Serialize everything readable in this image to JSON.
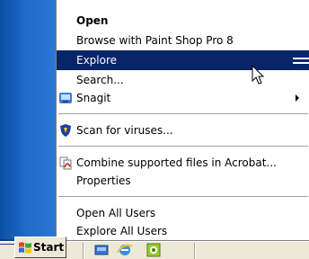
{
  "context_menu": {
    "items": [
      {
        "label": "Open"
      },
      {
        "label": "Browse with Paint Shop Pro 8"
      },
      {
        "label": "Explore"
      },
      {
        "label": "Search..."
      },
      {
        "label": "Snagit"
      },
      {
        "label": "Scan for viruses..."
      },
      {
        "label": "Combine supported files in Acrobat..."
      },
      {
        "label": "Properties"
      },
      {
        "label": "Open All Users"
      },
      {
        "label": "Explore All Users"
      }
    ],
    "highlighted_item": "Explore"
  },
  "taskbar": {
    "start_label": "Start"
  },
  "colors": {
    "menu_highlight": "#0a246a",
    "desktop_blue": "#1e6bc8"
  },
  "icons": [
    "snagit-icon",
    "antivirus-shield-icon",
    "acrobat-icon",
    "windows-logo-icon",
    "show-desktop-icon",
    "internet-explorer-icon",
    "media-icon",
    "mouse-pointer-icon"
  ]
}
